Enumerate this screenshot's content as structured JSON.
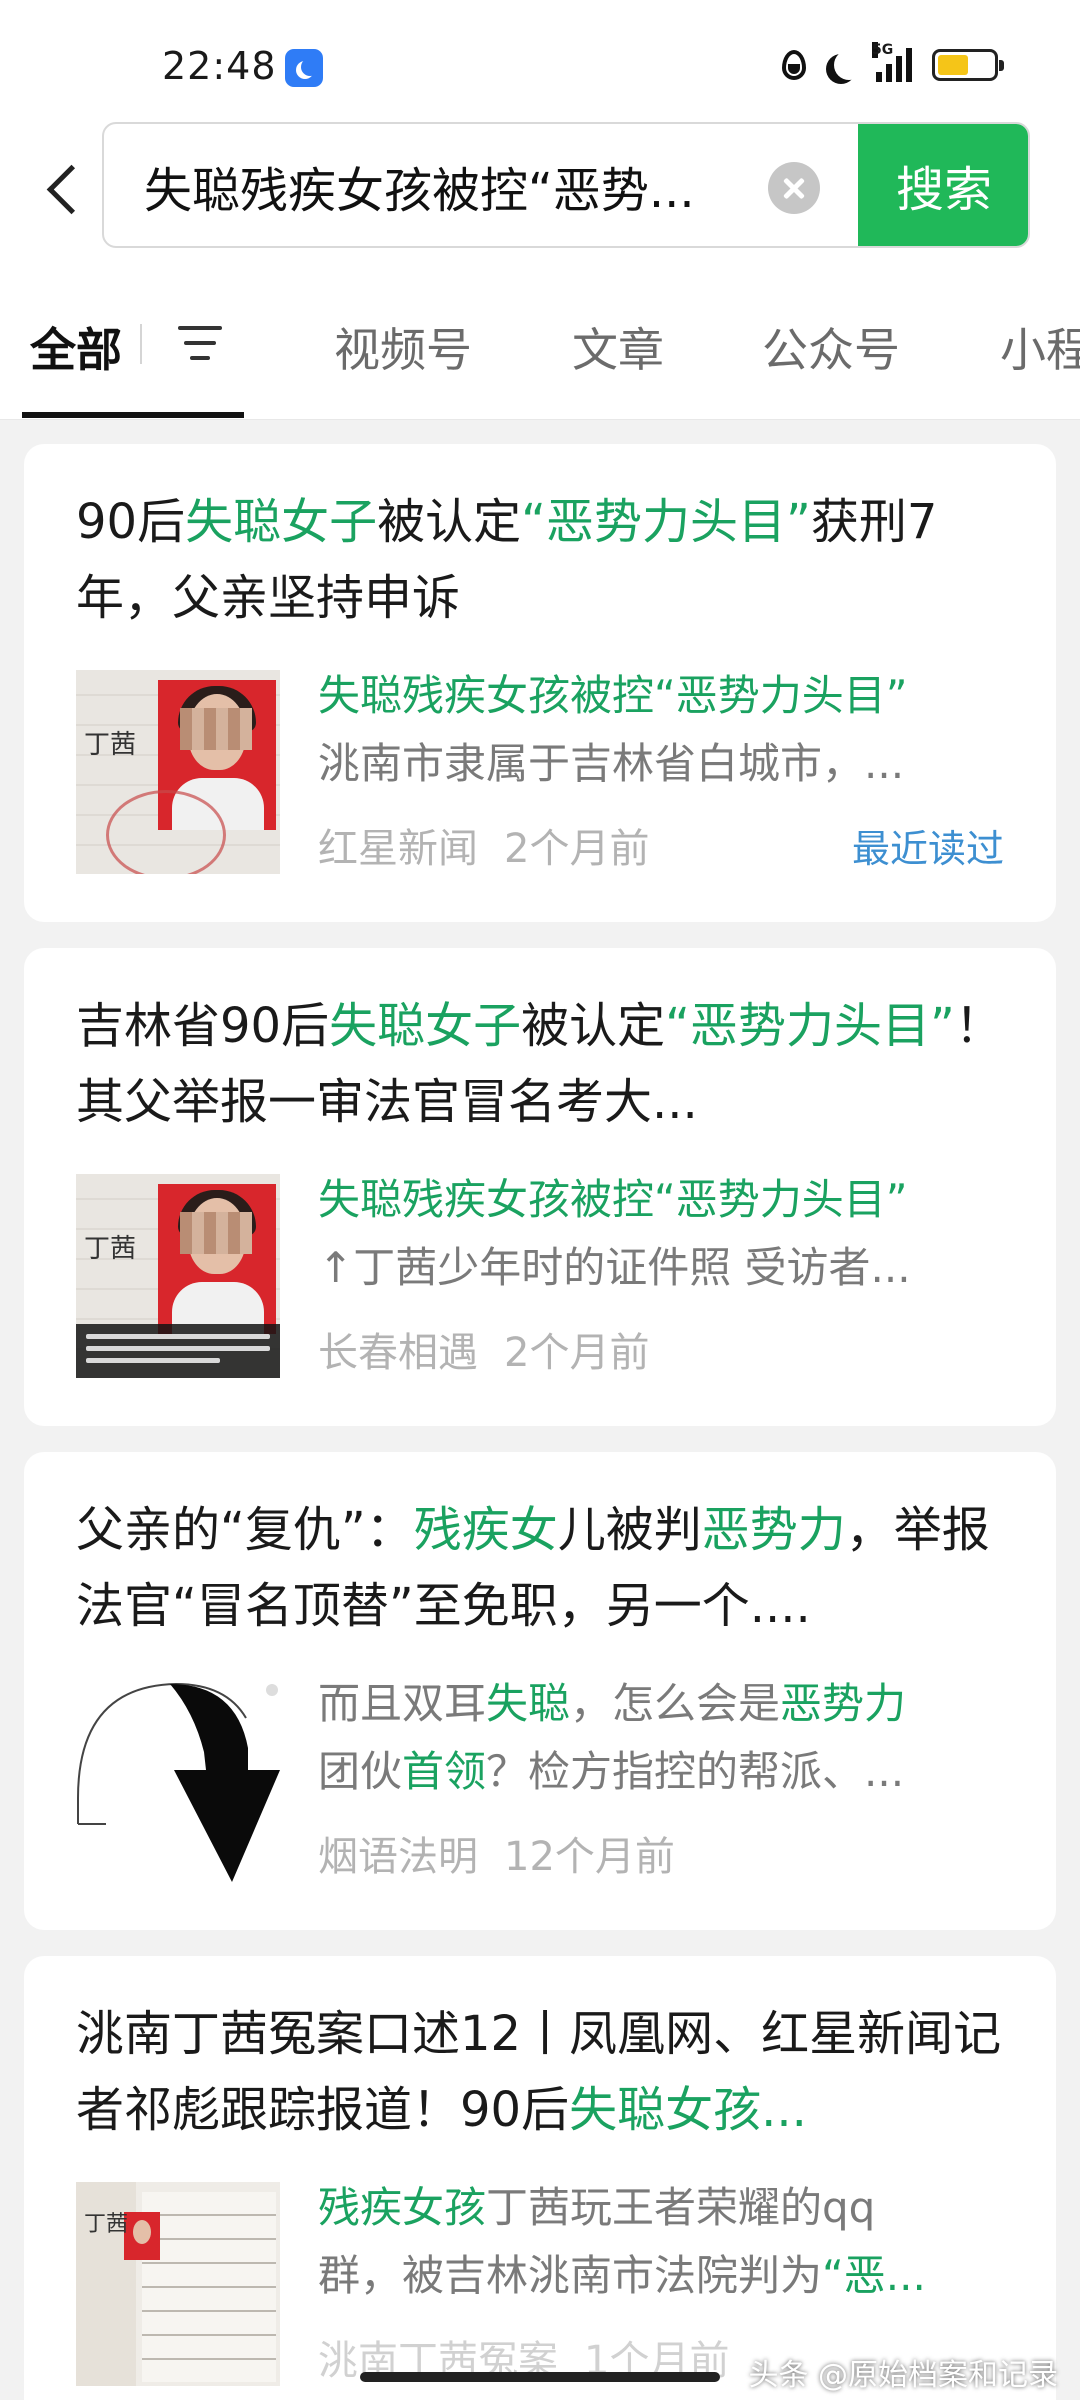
{
  "status_bar": {
    "time": "22:48",
    "network": "5G",
    "battery_level": 0.55,
    "icons": [
      "moon-badge-icon",
      "water-drop-icon",
      "do-not-disturb-moon-icon",
      "signal-5g-icon",
      "battery-icon"
    ]
  },
  "search": {
    "query": "失聪残疾女孩被控“恶势...",
    "button": "搜索"
  },
  "tabs": [
    {
      "label": "全部",
      "active": true
    },
    {
      "label": "视频号"
    },
    {
      "label": "文章"
    },
    {
      "label": "公众号"
    },
    {
      "label": "小程"
    }
  ],
  "results": [
    {
      "title_parts": [
        {
          "text": "90后"
        },
        {
          "text": "失聪女子",
          "hl": true
        },
        {
          "text": "被认定"
        },
        {
          "text": "“恶势力头目”",
          "hl": true
        },
        {
          "text": "获刑7年，父亲坚持申诉"
        }
      ],
      "snippet_title": "失聪残疾女孩被控“恶势力头目”",
      "snippet_parts": [
        {
          "text": "洮南市隶属于吉林省白城市，..."
        }
      ],
      "source": "红星新闻",
      "time": "2个月前",
      "badge": "最近读过",
      "thumb_text": "丁茜"
    },
    {
      "title_parts": [
        {
          "text": "吉林省90后"
        },
        {
          "text": "失聪女子",
          "hl": true
        },
        {
          "text": "被认定"
        },
        {
          "text": "“恶势力头目”",
          "hl": true
        },
        {
          "text": "！其父举报一审法官冒名考大..."
        }
      ],
      "snippet_title": "失聪残疾女孩被控“恶势力头目”",
      "snippet_parts": [
        {
          "text": "↑丁茜少年时的证件照 受访者..."
        }
      ],
      "source": "长春相遇",
      "time": "2个月前",
      "thumb_text": "丁茜"
    },
    {
      "title_parts": [
        {
          "text": "父亲的“复仇”："
        },
        {
          "text": "残疾女",
          "hl": true
        },
        {
          "text": "儿被判"
        },
        {
          "text": "恶势力",
          "hl": true
        },
        {
          "text": "，举报法官“冒名顶替”至免职，另一个...."
        }
      ],
      "snippet_line1_parts": [
        {
          "text": "而且双耳"
        },
        {
          "text": "失聪",
          "hl": true
        },
        {
          "text": "，怎么会是"
        },
        {
          "text": "恶势力",
          "hl": true
        }
      ],
      "snippet_line2_parts": [
        {
          "text": "团伙"
        },
        {
          "text": "首领",
          "hl": true
        },
        {
          "text": "？检方指控的帮派、..."
        }
      ],
      "source": "烟语法明",
      "time": "12个月前"
    },
    {
      "title_parts": [
        {
          "text": "洮南丁茜冤案口述12丨凤凰网、红星新闻记者祁彪跟踪报道！90后"
        },
        {
          "text": "失聪女孩...",
          "hl": true
        }
      ],
      "snippet_line1_parts": [
        {
          "text": "残疾女孩",
          "hl": true
        },
        {
          "text": "丁茜玩王者荣耀的qq"
        }
      ],
      "snippet_line2_parts": [
        {
          "text": "群，被吉林洮南市法院判为"
        },
        {
          "text": "“恶...",
          "hl": true
        }
      ],
      "source": "洮南丁茜冤案",
      "time": "1个月前",
      "thumb_text": "丁茜"
    }
  ],
  "watermark": "头条 @原始档案和记录",
  "colors": {
    "accent": "#20b859",
    "highlight": "#1aa260",
    "read_badge": "#3d8fd1"
  }
}
